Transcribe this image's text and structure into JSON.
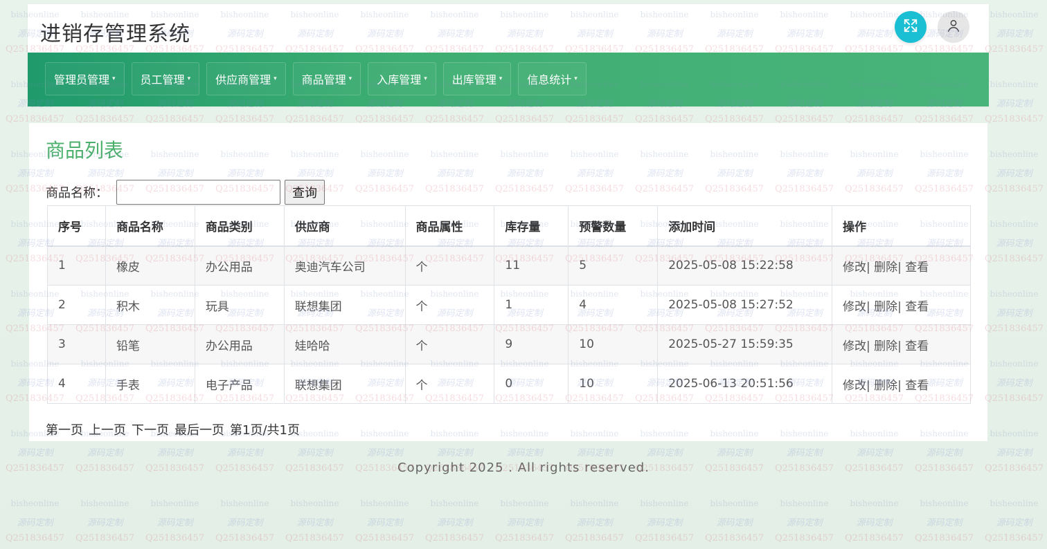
{
  "app": {
    "title": "进销存管理系统"
  },
  "header_icons": {
    "fullscreen": "fullscreen-icon",
    "user": "user-icon"
  },
  "nav": {
    "items": [
      {
        "label": "管理员管理"
      },
      {
        "label": "员工管理"
      },
      {
        "label": "供应商管理"
      },
      {
        "label": "商品管理"
      },
      {
        "label": "入库管理"
      },
      {
        "label": "出库管理"
      },
      {
        "label": "信息统计"
      }
    ]
  },
  "page": {
    "title": "商品列表",
    "search_label": "商品名称：",
    "search_value": "",
    "search_button": "查询"
  },
  "table": {
    "headers": [
      "序号",
      "商品名称",
      "商品类别",
      "供应商",
      "商品属性",
      "库存量",
      "预警数量",
      "添加时间",
      "操作"
    ],
    "rows": [
      {
        "id": "1",
        "name": "橡皮",
        "category": "办公用品",
        "supplier": "奥迪汽车公司",
        "attr": "个",
        "stock": "11",
        "warn": "5",
        "time": "2025-05-08 15:22:58"
      },
      {
        "id": "2",
        "name": "积木",
        "category": "玩具",
        "supplier": "联想集团",
        "attr": "个",
        "stock": "1",
        "warn": "4",
        "time": "2025-05-08 15:27:52"
      },
      {
        "id": "3",
        "name": "铅笔",
        "category": "办公用品",
        "supplier": "娃哈哈",
        "attr": "个",
        "stock": "9",
        "warn": "10",
        "time": "2025-05-27 15:59:35"
      },
      {
        "id": "4",
        "name": "手表",
        "category": "电子产品",
        "supplier": "联想集团",
        "attr": "个",
        "stock": "0",
        "warn": "10",
        "time": "2025-06-13 20:51:56"
      }
    ],
    "ops": {
      "edit": "修改|",
      "delete": "删除|",
      "view": "查看"
    }
  },
  "pager": {
    "first": "第一页",
    "prev": "上一页",
    "next": "下一页",
    "last": "最后一页",
    "info": "第1页/共1页"
  },
  "footer": {
    "copyright": "Copyright 2025 . All rights reserved."
  },
  "watermark": {
    "line_a": "bisheonline",
    "line_b": "源码定制",
    "line_c": "Q251836457"
  },
  "colors": {
    "accent_green": "#4cb06d",
    "nav_gradient_start": "#1f9a6b",
    "nav_gradient_end": "#49b47a",
    "fullscreen_btn": "#1bbfd3"
  }
}
